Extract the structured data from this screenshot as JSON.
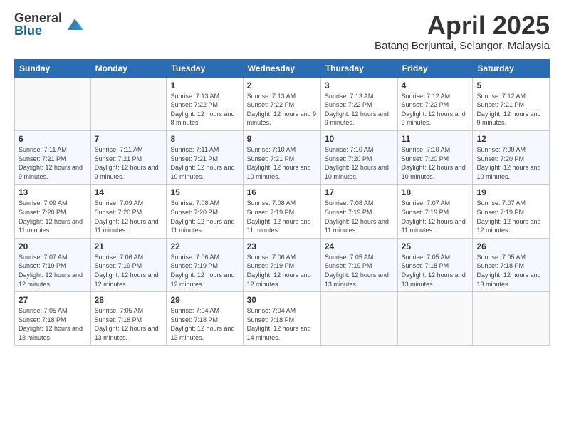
{
  "logo": {
    "general": "General",
    "blue": "Blue"
  },
  "title": "April 2025",
  "location": "Batang Berjuntai, Selangor, Malaysia",
  "days_of_week": [
    "Sunday",
    "Monday",
    "Tuesday",
    "Wednesday",
    "Thursday",
    "Friday",
    "Saturday"
  ],
  "weeks": [
    [
      {
        "day": "",
        "info": ""
      },
      {
        "day": "",
        "info": ""
      },
      {
        "day": "1",
        "info": "Sunrise: 7:13 AM\nSunset: 7:22 PM\nDaylight: 12 hours and 8 minutes."
      },
      {
        "day": "2",
        "info": "Sunrise: 7:13 AM\nSunset: 7:22 PM\nDaylight: 12 hours and 9 minutes."
      },
      {
        "day": "3",
        "info": "Sunrise: 7:13 AM\nSunset: 7:22 PM\nDaylight: 12 hours and 9 minutes."
      },
      {
        "day": "4",
        "info": "Sunrise: 7:12 AM\nSunset: 7:22 PM\nDaylight: 12 hours and 9 minutes."
      },
      {
        "day": "5",
        "info": "Sunrise: 7:12 AM\nSunset: 7:21 PM\nDaylight: 12 hours and 9 minutes."
      }
    ],
    [
      {
        "day": "6",
        "info": "Sunrise: 7:11 AM\nSunset: 7:21 PM\nDaylight: 12 hours and 9 minutes."
      },
      {
        "day": "7",
        "info": "Sunrise: 7:11 AM\nSunset: 7:21 PM\nDaylight: 12 hours and 9 minutes."
      },
      {
        "day": "8",
        "info": "Sunrise: 7:11 AM\nSunset: 7:21 PM\nDaylight: 12 hours and 10 minutes."
      },
      {
        "day": "9",
        "info": "Sunrise: 7:10 AM\nSunset: 7:21 PM\nDaylight: 12 hours and 10 minutes."
      },
      {
        "day": "10",
        "info": "Sunrise: 7:10 AM\nSunset: 7:20 PM\nDaylight: 12 hours and 10 minutes."
      },
      {
        "day": "11",
        "info": "Sunrise: 7:10 AM\nSunset: 7:20 PM\nDaylight: 12 hours and 10 minutes."
      },
      {
        "day": "12",
        "info": "Sunrise: 7:09 AM\nSunset: 7:20 PM\nDaylight: 12 hours and 10 minutes."
      }
    ],
    [
      {
        "day": "13",
        "info": "Sunrise: 7:09 AM\nSunset: 7:20 PM\nDaylight: 12 hours and 11 minutes."
      },
      {
        "day": "14",
        "info": "Sunrise: 7:09 AM\nSunset: 7:20 PM\nDaylight: 12 hours and 11 minutes."
      },
      {
        "day": "15",
        "info": "Sunrise: 7:08 AM\nSunset: 7:20 PM\nDaylight: 12 hours and 11 minutes."
      },
      {
        "day": "16",
        "info": "Sunrise: 7:08 AM\nSunset: 7:19 PM\nDaylight: 12 hours and 11 minutes."
      },
      {
        "day": "17",
        "info": "Sunrise: 7:08 AM\nSunset: 7:19 PM\nDaylight: 12 hours and 11 minutes."
      },
      {
        "day": "18",
        "info": "Sunrise: 7:07 AM\nSunset: 7:19 PM\nDaylight: 12 hours and 11 minutes."
      },
      {
        "day": "19",
        "info": "Sunrise: 7:07 AM\nSunset: 7:19 PM\nDaylight: 12 hours and 12 minutes."
      }
    ],
    [
      {
        "day": "20",
        "info": "Sunrise: 7:07 AM\nSunset: 7:19 PM\nDaylight: 12 hours and 12 minutes."
      },
      {
        "day": "21",
        "info": "Sunrise: 7:06 AM\nSunset: 7:19 PM\nDaylight: 12 hours and 12 minutes."
      },
      {
        "day": "22",
        "info": "Sunrise: 7:06 AM\nSunset: 7:19 PM\nDaylight: 12 hours and 12 minutes."
      },
      {
        "day": "23",
        "info": "Sunrise: 7:06 AM\nSunset: 7:19 PM\nDaylight: 12 hours and 12 minutes."
      },
      {
        "day": "24",
        "info": "Sunrise: 7:05 AM\nSunset: 7:19 PM\nDaylight: 12 hours and 13 minutes."
      },
      {
        "day": "25",
        "info": "Sunrise: 7:05 AM\nSunset: 7:18 PM\nDaylight: 12 hours and 13 minutes."
      },
      {
        "day": "26",
        "info": "Sunrise: 7:05 AM\nSunset: 7:18 PM\nDaylight: 12 hours and 13 minutes."
      }
    ],
    [
      {
        "day": "27",
        "info": "Sunrise: 7:05 AM\nSunset: 7:18 PM\nDaylight: 12 hours and 13 minutes."
      },
      {
        "day": "28",
        "info": "Sunrise: 7:05 AM\nSunset: 7:18 PM\nDaylight: 12 hours and 13 minutes."
      },
      {
        "day": "29",
        "info": "Sunrise: 7:04 AM\nSunset: 7:18 PM\nDaylight: 12 hours and 13 minutes."
      },
      {
        "day": "30",
        "info": "Sunrise: 7:04 AM\nSunset: 7:18 PM\nDaylight: 12 hours and 14 minutes."
      },
      {
        "day": "",
        "info": ""
      },
      {
        "day": "",
        "info": ""
      },
      {
        "day": "",
        "info": ""
      }
    ]
  ]
}
